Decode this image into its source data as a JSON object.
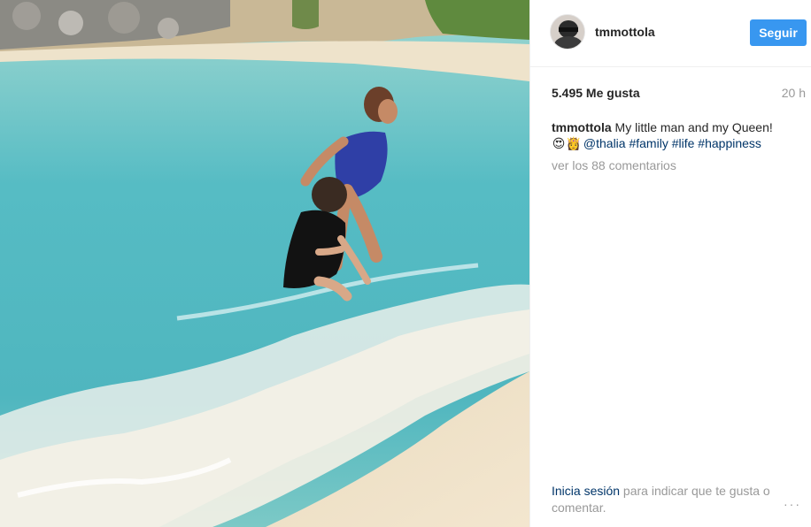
{
  "post": {
    "username": "tmmottola",
    "follow_label": "Seguir",
    "likes": "5.495 Me gusta",
    "time": "20 h",
    "caption_user": "tmmottola",
    "caption_text": " My little man and my Queen!",
    "caption_emoji_1": "😍",
    "caption_emoji_2": "👸",
    "caption_mention": "@thalia",
    "caption_tags": [
      "#family",
      "#life",
      "#happiness"
    ],
    "comments_link": "ver los 88 comentarios"
  },
  "footer": {
    "login_link": "Inicia sesión",
    "rest": " para indicar que te gusta o comentar.",
    "more_icon": "···"
  },
  "colors": {
    "follow_button": "#3897f0",
    "link": "#003569",
    "muted": "#999999"
  }
}
